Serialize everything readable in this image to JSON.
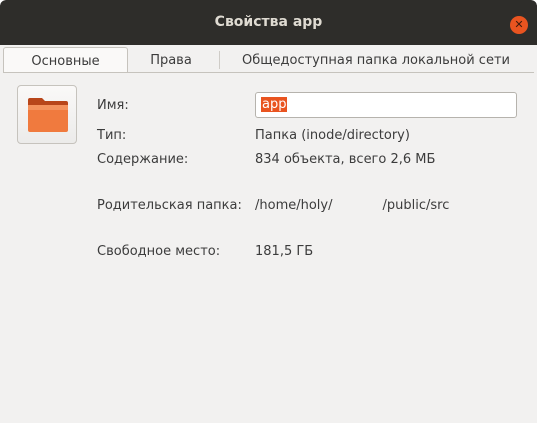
{
  "window": {
    "title": "Свойства app",
    "close_symbol": "✕"
  },
  "tabs": [
    {
      "label": "Основные",
      "active": true
    },
    {
      "label": "Права",
      "active": false
    },
    {
      "label": "Общедоступная папка локальной сети",
      "active": false
    }
  ],
  "basic": {
    "icon": "folder-icon",
    "name_label": "Имя:",
    "name_value": "app",
    "type_label": "Тип:",
    "type_value": "Папка (inode/directory)",
    "contents_label": "Содержание:",
    "contents_value": "834 объекта, всего 2,6 МБ",
    "parent_label": "Родительская папка:",
    "parent_value_start": "/home/holy/",
    "parent_value_end": "/public/src",
    "free_label": "Свободное место:",
    "free_value": "181,5 ГБ"
  },
  "colors": {
    "accent": "#e95420",
    "titlebar": "#2e2d2a",
    "background": "#f2f1f0"
  }
}
